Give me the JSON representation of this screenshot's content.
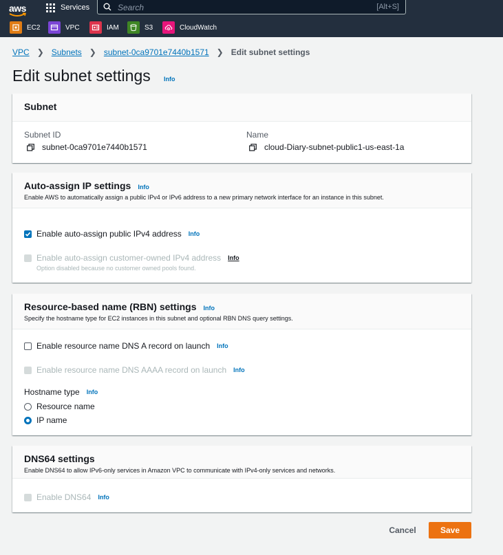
{
  "nav": {
    "logo_text": "aws",
    "services_label": "Services",
    "search_placeholder": "Search",
    "search_shortcut": "[Alt+S]",
    "favorites": [
      {
        "label": "EC2",
        "color": "#e07c14"
      },
      {
        "label": "VPC",
        "color": "#7b45d6"
      },
      {
        "label": "IAM",
        "color": "#dd344c"
      },
      {
        "label": "S3",
        "color": "#3f8624"
      },
      {
        "label": "CloudWatch",
        "color": "#e7157b"
      }
    ]
  },
  "breadcrumb": {
    "items": [
      "VPC",
      "Subnets",
      "subnet-0ca9701e7440b1571"
    ],
    "current": "Edit subnet settings"
  },
  "page": {
    "title": "Edit subnet settings",
    "info": "Info"
  },
  "subnet_panel": {
    "title": "Subnet",
    "subnet_id_label": "Subnet ID",
    "subnet_id_value": "subnet-0ca9701e7440b1571",
    "name_label": "Name",
    "name_value": "cloud-Diary-subnet-public1-us-east-1a"
  },
  "auto_assign": {
    "title": "Auto-assign IP settings",
    "info": "Info",
    "description": "Enable AWS to automatically assign a public IPv4 or IPv6 address to a new primary network interface for an instance in this subnet.",
    "ipv4_label": "Enable auto-assign public IPv4 address",
    "ipv4_checked": true,
    "customer_label": "Enable auto-assign customer-owned IPv4 address",
    "customer_note": "Option disabled because no customer owned pools found."
  },
  "rbn": {
    "title": "Resource-based name (RBN) settings",
    "info": "Info",
    "description": "Specify the hostname type for EC2 instances in this subnet and optional RBN DNS query settings.",
    "dns_a_label": "Enable resource name DNS A record on launch",
    "dns_aaaa_label": "Enable resource name DNS AAAA record on launch",
    "hostname_type_label": "Hostname type",
    "options": [
      "Resource name",
      "IP name"
    ],
    "selected": "IP name"
  },
  "dns64": {
    "title": "DNS64 settings",
    "description": "Enable DNS64 to allow IPv6-only services in Amazon VPC to communicate with IPv4-only services and networks.",
    "enable_label": "Enable DNS64",
    "info": "Info"
  },
  "actions": {
    "cancel": "Cancel",
    "save": "Save"
  },
  "colors": {
    "accent": "#0073bb",
    "primary_button": "#ec7211",
    "topbar": "#232f3e"
  }
}
